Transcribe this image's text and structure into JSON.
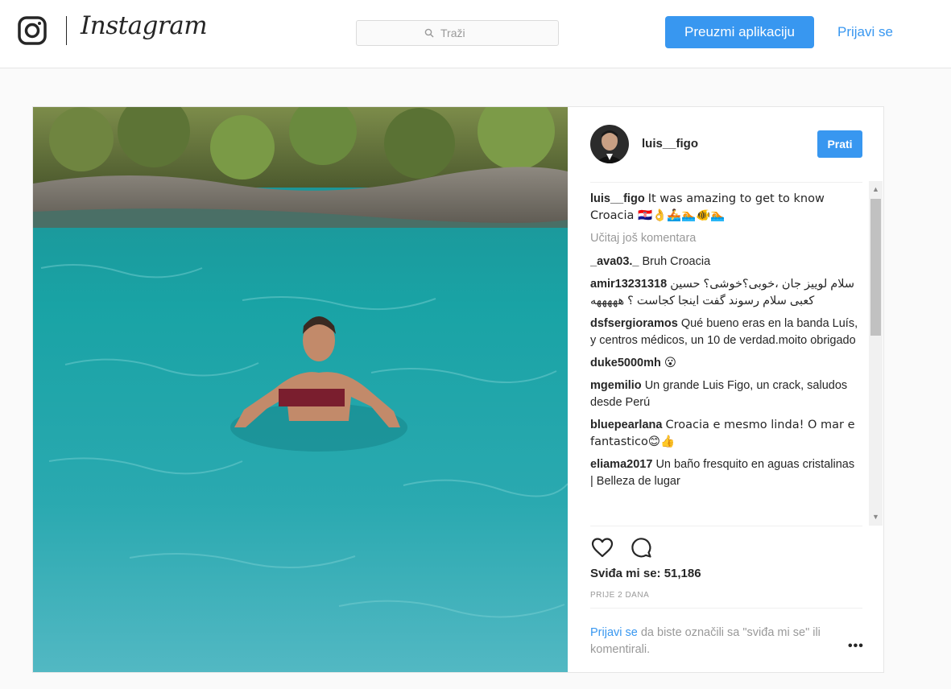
{
  "header": {
    "logo_text": "Instagram",
    "search": {
      "placeholder": "Traži"
    },
    "download_button": "Preuzmi aplikaciju",
    "login_link": "Prijavi se"
  },
  "post": {
    "username": "luis__figo",
    "follow_button": "Prati",
    "caption": {
      "author": "luis__figo",
      "text": "It was amazing to get to know Croacia 🇭🇷👌🚣🏊🐠🏊"
    },
    "load_more": "Učitaj još komentara",
    "comments": [
      {
        "author": "_ava03._",
        "text": "Bruh Croacia"
      },
      {
        "author": "amir13231318",
        "text": "سلام لوییز جان ،خوبی؟خوشی؟ حسین کعبی سلام رسوند گفت اینجا کجاست ؟ هههههه"
      },
      {
        "author": "dsfsergioramos",
        "text": "Qué bueno eras en la banda Luís, y centros médicos, un 10 de verdad.moito obrigado"
      },
      {
        "author": "duke5000mh",
        "text": "😮"
      },
      {
        "author": "mgemilio",
        "text": "Un grande Luis Figo, un crack, saludos desde Perú"
      },
      {
        "author": "bluepearlana",
        "text": "Croacia e mesmo linda! O mar e fantastico😊👍"
      },
      {
        "author": "eliama2017",
        "text": "Un baño fresquito en aguas cristalinas | Belleza de lugar"
      }
    ],
    "likes": "Sviđa mi se: 51,186",
    "timestamp": "PRIJE 2 DANA",
    "login_prompt": {
      "link": "Prijavi se",
      "text": " da biste označili sa \"sviđa mi se\" ili komentirali."
    },
    "more_options": "•••"
  },
  "colors": {
    "accent": "#3897f0",
    "text": "#262626",
    "muted": "#999999",
    "border": "#e6e6e6"
  },
  "icons": [
    "instagram-logo-icon",
    "search-icon",
    "heart-icon",
    "comment-icon",
    "more-options-icon"
  ]
}
